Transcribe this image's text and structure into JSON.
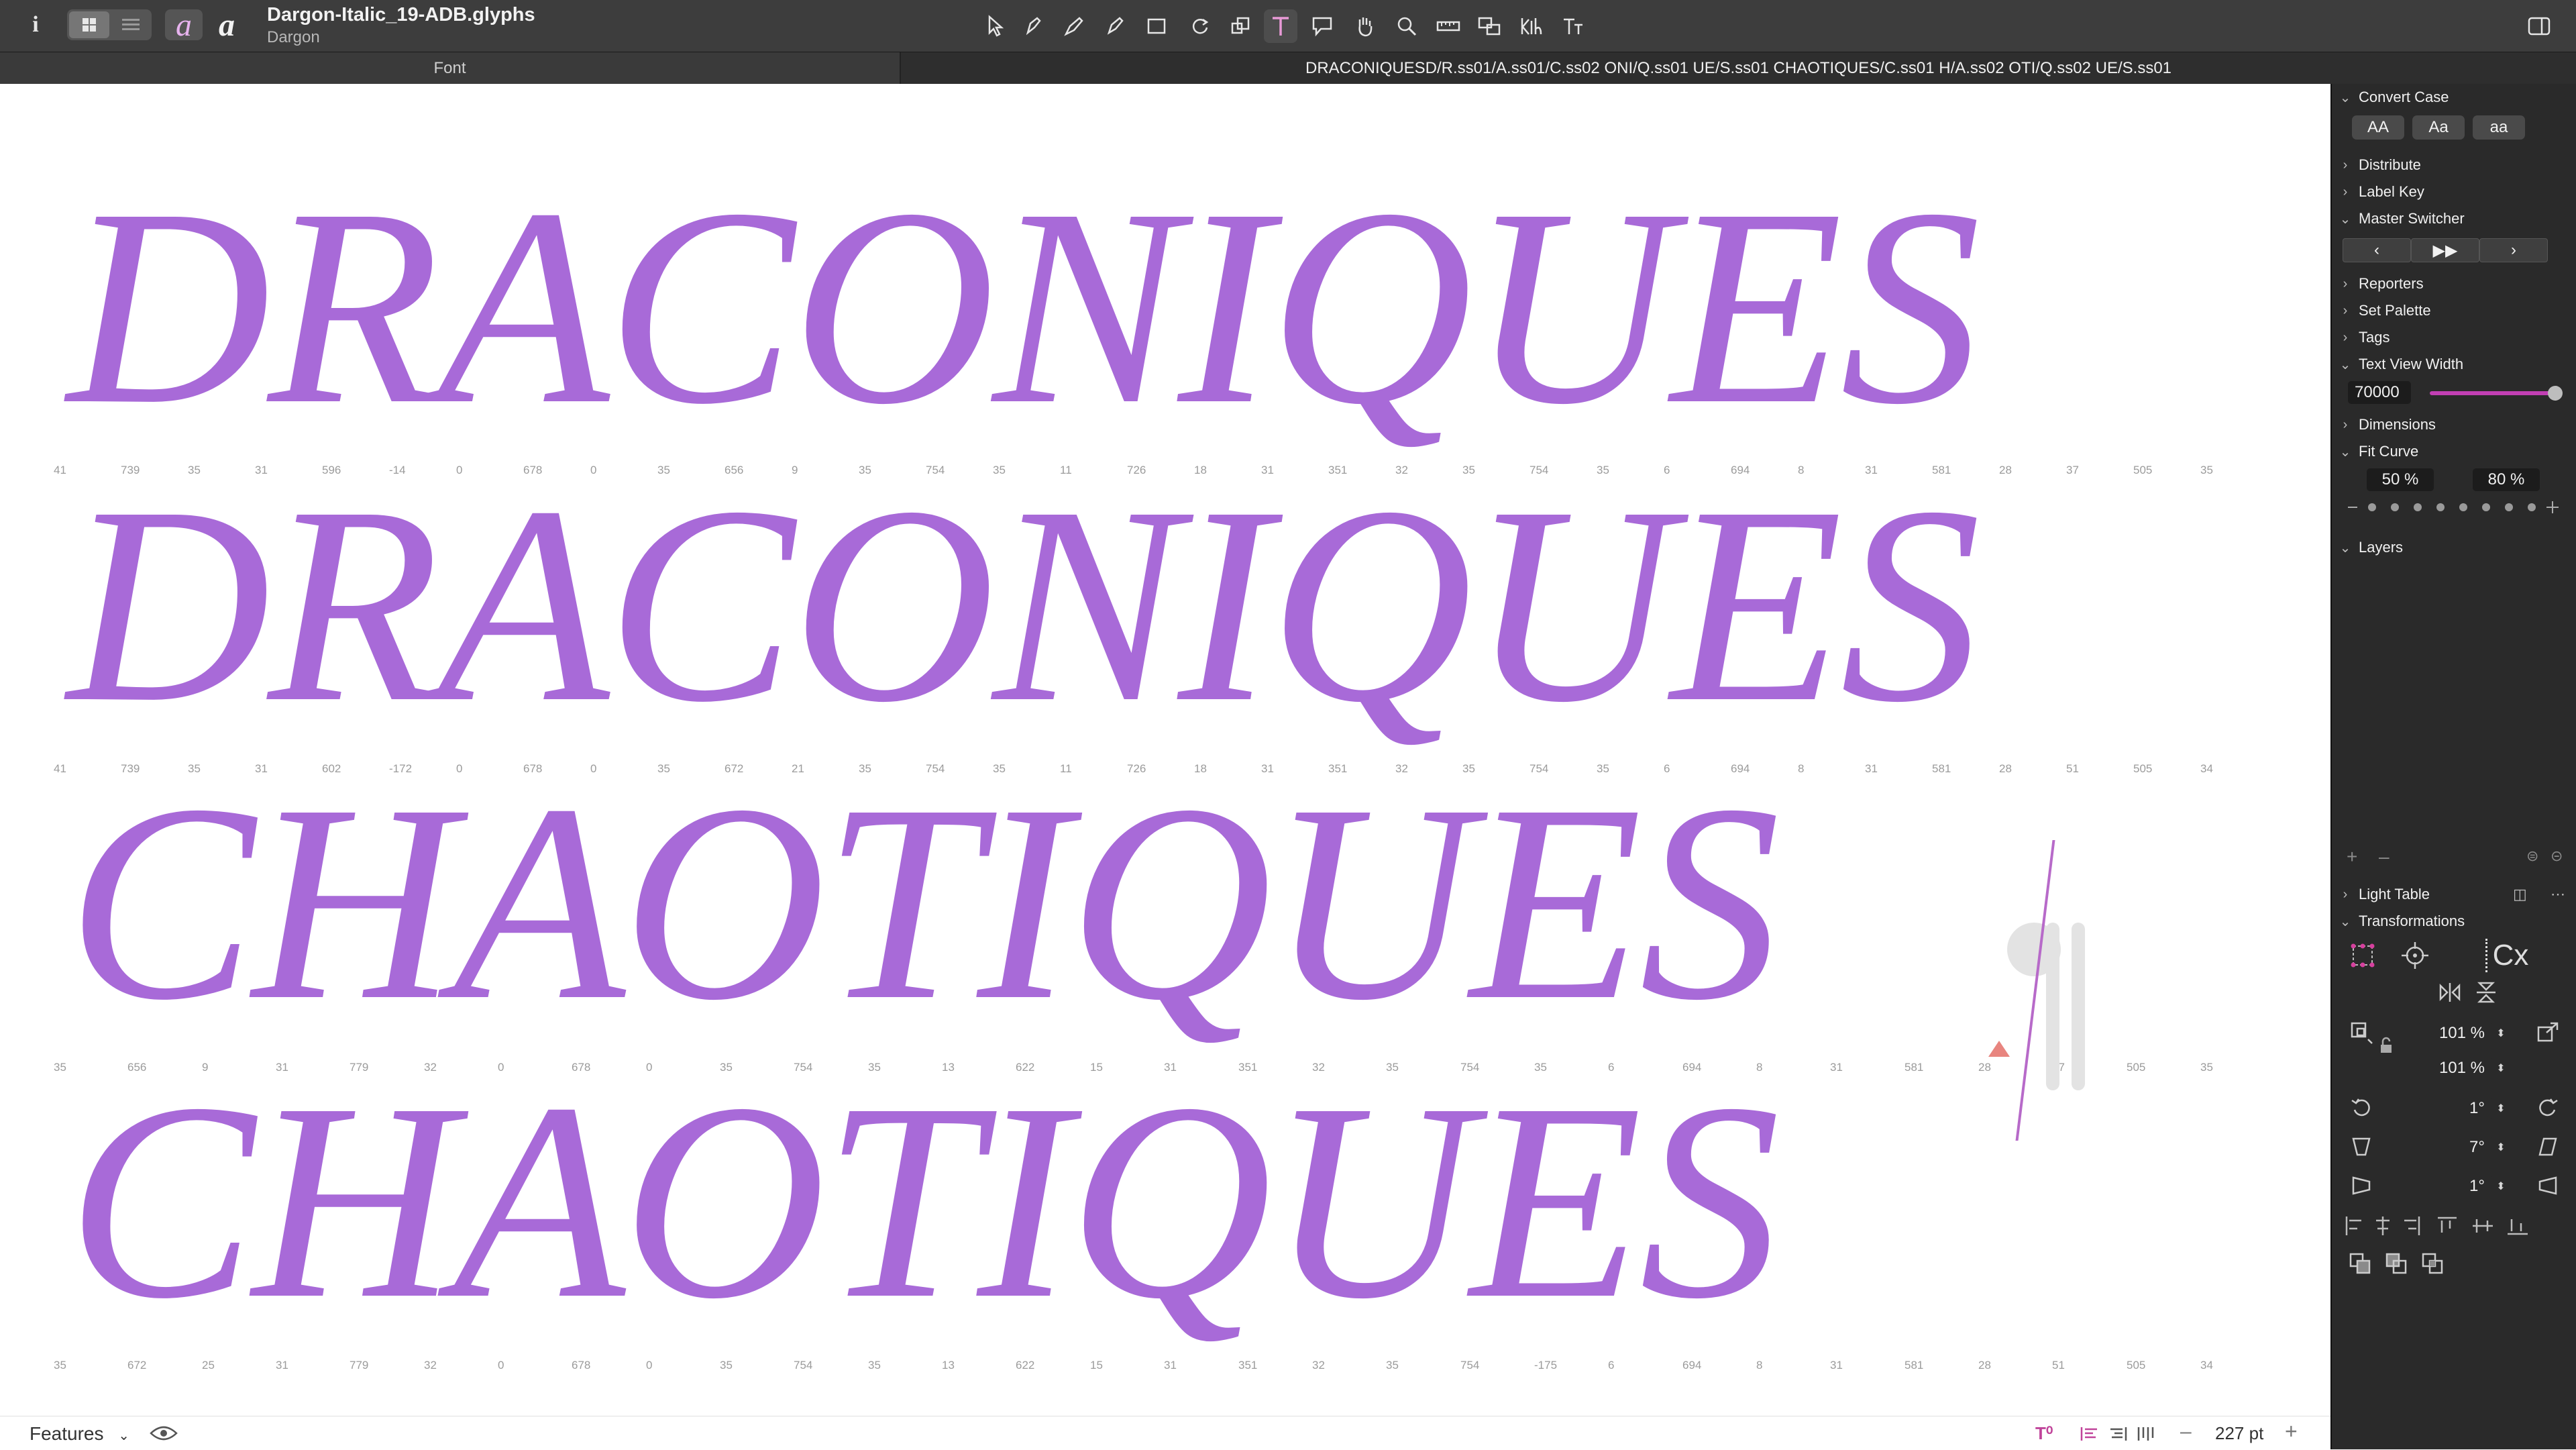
{
  "titlebar": {
    "info_icon": "info-icon",
    "file_name": "Dargon-Italic_19-ADB.glyphs",
    "family_name": "Dargon",
    "glyph_a_label": "a"
  },
  "tabs": {
    "font_tab": "Font",
    "text_tab": "DRACONIQUESD/R.ss01/A.ss01/C.ss02 ONI/Q.ss01 UE/S.ss01 CHAOTIQUES/C.ss01 H/A.ss02 OTI/Q.ss02 UE/S.ss01"
  },
  "canvas": {
    "lines": [
      "DRACONIQUES",
      "DRACONIQUES",
      "CHAOTIQUES",
      "CHAOTIQUES"
    ],
    "metrics": [
      [
        "41",
        "739",
        "35",
        "31",
        "596",
        "-14",
        "0",
        "678",
        "0",
        "35",
        "656",
        "9",
        "35",
        "754",
        "35",
        "11",
        "726",
        "18",
        "31",
        "351",
        "32",
        "35",
        "754",
        "35",
        "6",
        "694",
        "8",
        "31",
        "581",
        "28",
        "37",
        "505",
        "35"
      ],
      [
        "41",
        "739",
        "35",
        "31",
        "602",
        "-172",
        "0",
        "678",
        "0",
        "35",
        "672",
        "21",
        "35",
        "754",
        "35",
        "11",
        "726",
        "18",
        "31",
        "351",
        "32",
        "35",
        "754",
        "35",
        "6",
        "694",
        "8",
        "31",
        "581",
        "28",
        "51",
        "505",
        "34"
      ],
      [
        "35",
        "656",
        "9",
        "31",
        "779",
        "32",
        "0",
        "678",
        "0",
        "35",
        "754",
        "35",
        "13",
        "622",
        "15",
        "31",
        "351",
        "32",
        "35",
        "754",
        "35",
        "6",
        "694",
        "8",
        "31",
        "581",
        "28",
        "37",
        "505",
        "35"
      ],
      [
        "35",
        "672",
        "25",
        "31",
        "779",
        "32",
        "0",
        "678",
        "0",
        "35",
        "754",
        "35",
        "13",
        "622",
        "15",
        "31",
        "351",
        "32",
        "35",
        "754",
        "-175",
        "6",
        "694",
        "8",
        "31",
        "581",
        "28",
        "51",
        "505",
        "34"
      ]
    ],
    "text_color": "#a86ad8"
  },
  "bottombar": {
    "features_label": "Features",
    "zoom_value": "227 pt"
  },
  "sidebar": {
    "convert_case": "Convert Case",
    "case_upper": "AA",
    "case_title": "Aa",
    "case_lower": "aa",
    "distribute": "Distribute",
    "label_key": "Label Key",
    "master_switcher": "Master Switcher",
    "reporters": "Reporters",
    "set_palette": "Set Palette",
    "tags": "Tags",
    "text_view_width": "Text View Width",
    "text_view_width_value": "70000",
    "dimensions": "Dimensions",
    "fit_curve": "Fit Curve",
    "fit_min": "50 %",
    "fit_max": "80 %",
    "layers": "Layers",
    "light_table": "Light Table",
    "transformations": "Transformations",
    "cx_label": "Cx",
    "scale_x": "101 %",
    "scale_y": "101 %",
    "rotate": "1°",
    "slant": "7°",
    "skew": "1°"
  }
}
